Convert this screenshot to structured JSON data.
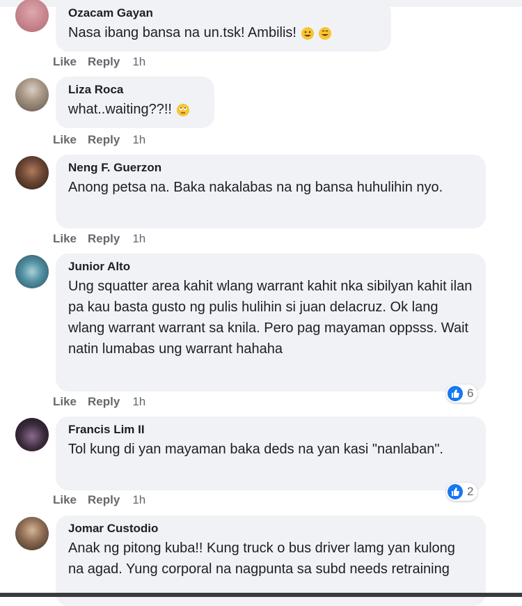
{
  "actions": {
    "like": "Like",
    "reply": "Reply"
  },
  "comments": [
    {
      "author": "Ozacam Gayan",
      "text": "Nasa ibang bansa na un.tsk! Ambilis!",
      "time": "1h",
      "avatar_color": "#c9838a"
    },
    {
      "author": "Liza Roca",
      "text": "what..waiting??!!",
      "time": "1h",
      "avatar_color": "#8d7f73"
    },
    {
      "author": "Neng F. Guerzon",
      "text": "Anong petsa na. Baka nakalabas na ng bansa huhulihin nyo.",
      "time": "1h",
      "avatar_color": "#5b3f2f"
    },
    {
      "author": "Junior Alto",
      "text": "Ung squatter area kahit wlang warrant kahit nka sibilyan kahit ilan pa kau basta gusto ng pulis hulihin si juan delacruz. Ok lang wlang warrant warrant sa knila. Pero pag mayaman oppsss. Wait natin lumabas ung warrant hahaha",
      "time": "1h",
      "reactions": "6",
      "avatar_color": "#5d8fa3"
    },
    {
      "author": "Francis Lim II",
      "text": "Tol kung di yan mayaman baka deds na yan kasi \"nanlaban\".",
      "time": "1h",
      "reactions": "2",
      "avatar_color": "#3b2a3d"
    },
    {
      "author": "Jomar Custodio",
      "text": "Anak ng pitong kuba!! Kung truck o bus driver lamg yan kulong na agad. Yung corporal na nagpunta sa subd needs retraining",
      "time": "",
      "avatar_color": "#6e5a48"
    }
  ]
}
